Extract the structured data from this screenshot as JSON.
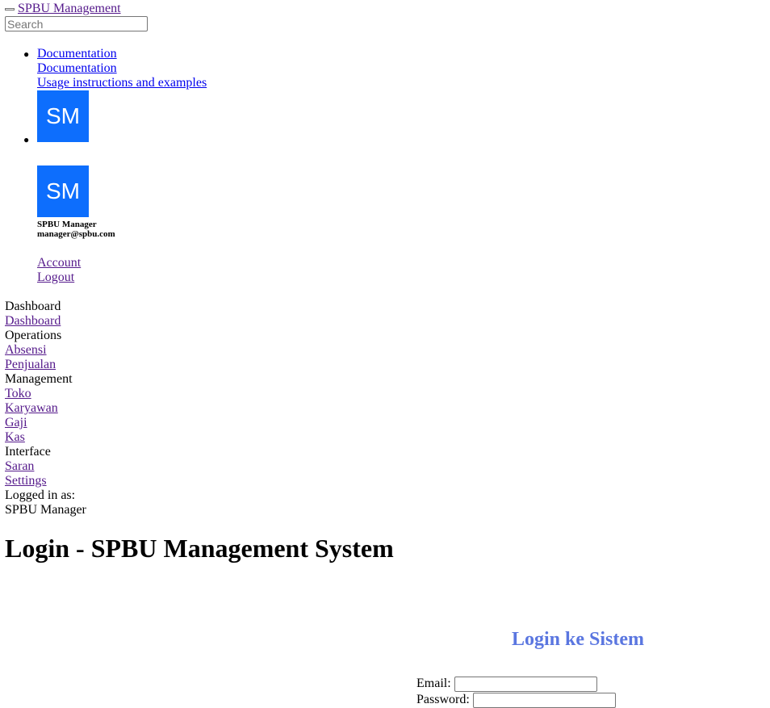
{
  "header": {
    "brand": "SPBU Management",
    "search_placeholder": "Search"
  },
  "nav": {
    "documentation_link": "Documentation",
    "documentation_title": "Documentation",
    "documentation_desc": "Usage instructions and examples"
  },
  "user": {
    "initials": "SM",
    "name": "SPBU Manager",
    "email": "manager@spbu.com",
    "account_label": "Account",
    "logout_label": "Logout"
  },
  "sidebar": {
    "dashboard_heading": "Dashboard",
    "dashboard_link": "Dashboard",
    "operations_heading": "Operations",
    "absensi": "Absensi",
    "penjualan": "Penjualan",
    "management_heading": "Management",
    "toko": "Toko",
    "karyawan": "Karyawan",
    "gaji": "Gaji",
    "kas": "Kas",
    "interface_heading": "Interface",
    "saran": "Saran",
    "settings": "Settings",
    "logged_in_label": "Logged in as:",
    "logged_in_user": "SPBU Manager"
  },
  "main": {
    "page_title": "Login - SPBU Management System",
    "login_heading": "Login ke Sistem",
    "email_label": "Email:",
    "password_label": "Password:"
  },
  "colors": {
    "avatar_bg": "#0d6efd",
    "login_heading": "#5a76e0"
  }
}
